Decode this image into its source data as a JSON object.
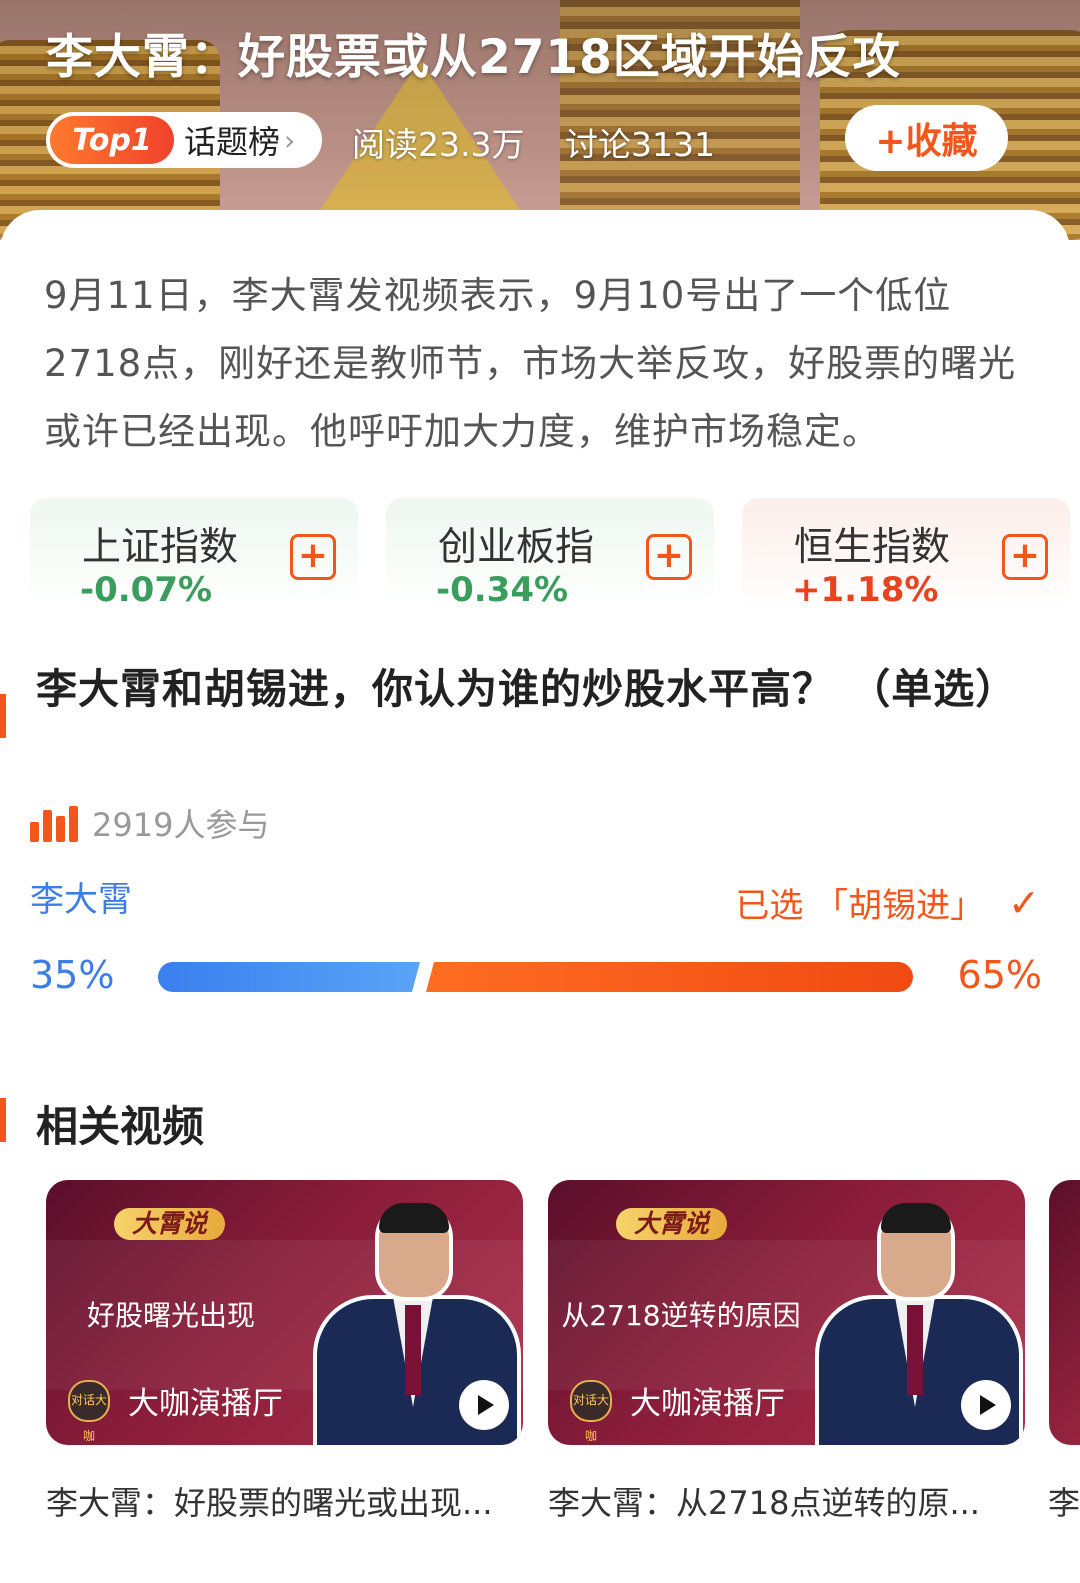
{
  "topic": {
    "title": "李大霄：好股票或从2718区域开始反攻",
    "rank_badge": "Top1",
    "rank_label": "话题榜",
    "rank_chevron": "›",
    "reads": "阅读23.3万",
    "discussions": "讨论3131",
    "collect_label": "+收藏",
    "summary": "9月11日，李大霄发视频表示，9月10号出了一个低位2718点，刚好还是教师节，市场大举反攻，好股票的曙光或许已经出现。他呼吁加大力度，维护市场稳定。"
  },
  "indices": [
    {
      "name": "上证指数",
      "change": "-0.07%",
      "trend": "down",
      "add_icon": "+"
    },
    {
      "name": "创业板指",
      "change": "-0.34%",
      "trend": "down",
      "add_icon": "+"
    },
    {
      "name": "恒生指数",
      "change": "+1.18%",
      "trend": "up",
      "add_icon": "+"
    }
  ],
  "poll": {
    "question": "李大霄和胡锡进，你认为谁的炒股水平高？ （单选）",
    "participants": "2919人参与",
    "option_left": "李大霄",
    "selected_text": "已选 「胡锡进」",
    "check_icon": "✓",
    "left_percent_label": "35%",
    "right_percent_label": "65%",
    "left_share": 0.35,
    "right_share": 0.65
  },
  "related": {
    "title": "相关视频",
    "videos": [
      {
        "tag": "大霄说",
        "headline": "好股曙光出现",
        "channel": "大咖演播厅",
        "avatar_text": "对话大咖",
        "caption": "李大霄：好股票的曙光或出现..."
      },
      {
        "tag": "大霄说",
        "headline": "从2718逆转的原因",
        "channel": "大咖演播厅",
        "avatar_text": "对话大咖",
        "caption": "李大霄：从2718点逆转的原..."
      }
    ],
    "partial_caption": "李"
  },
  "colors": {
    "accent": "#f2561b",
    "blue": "#3d7de8",
    "down_green": "#3a9d5d",
    "up_red": "#e8421f"
  }
}
